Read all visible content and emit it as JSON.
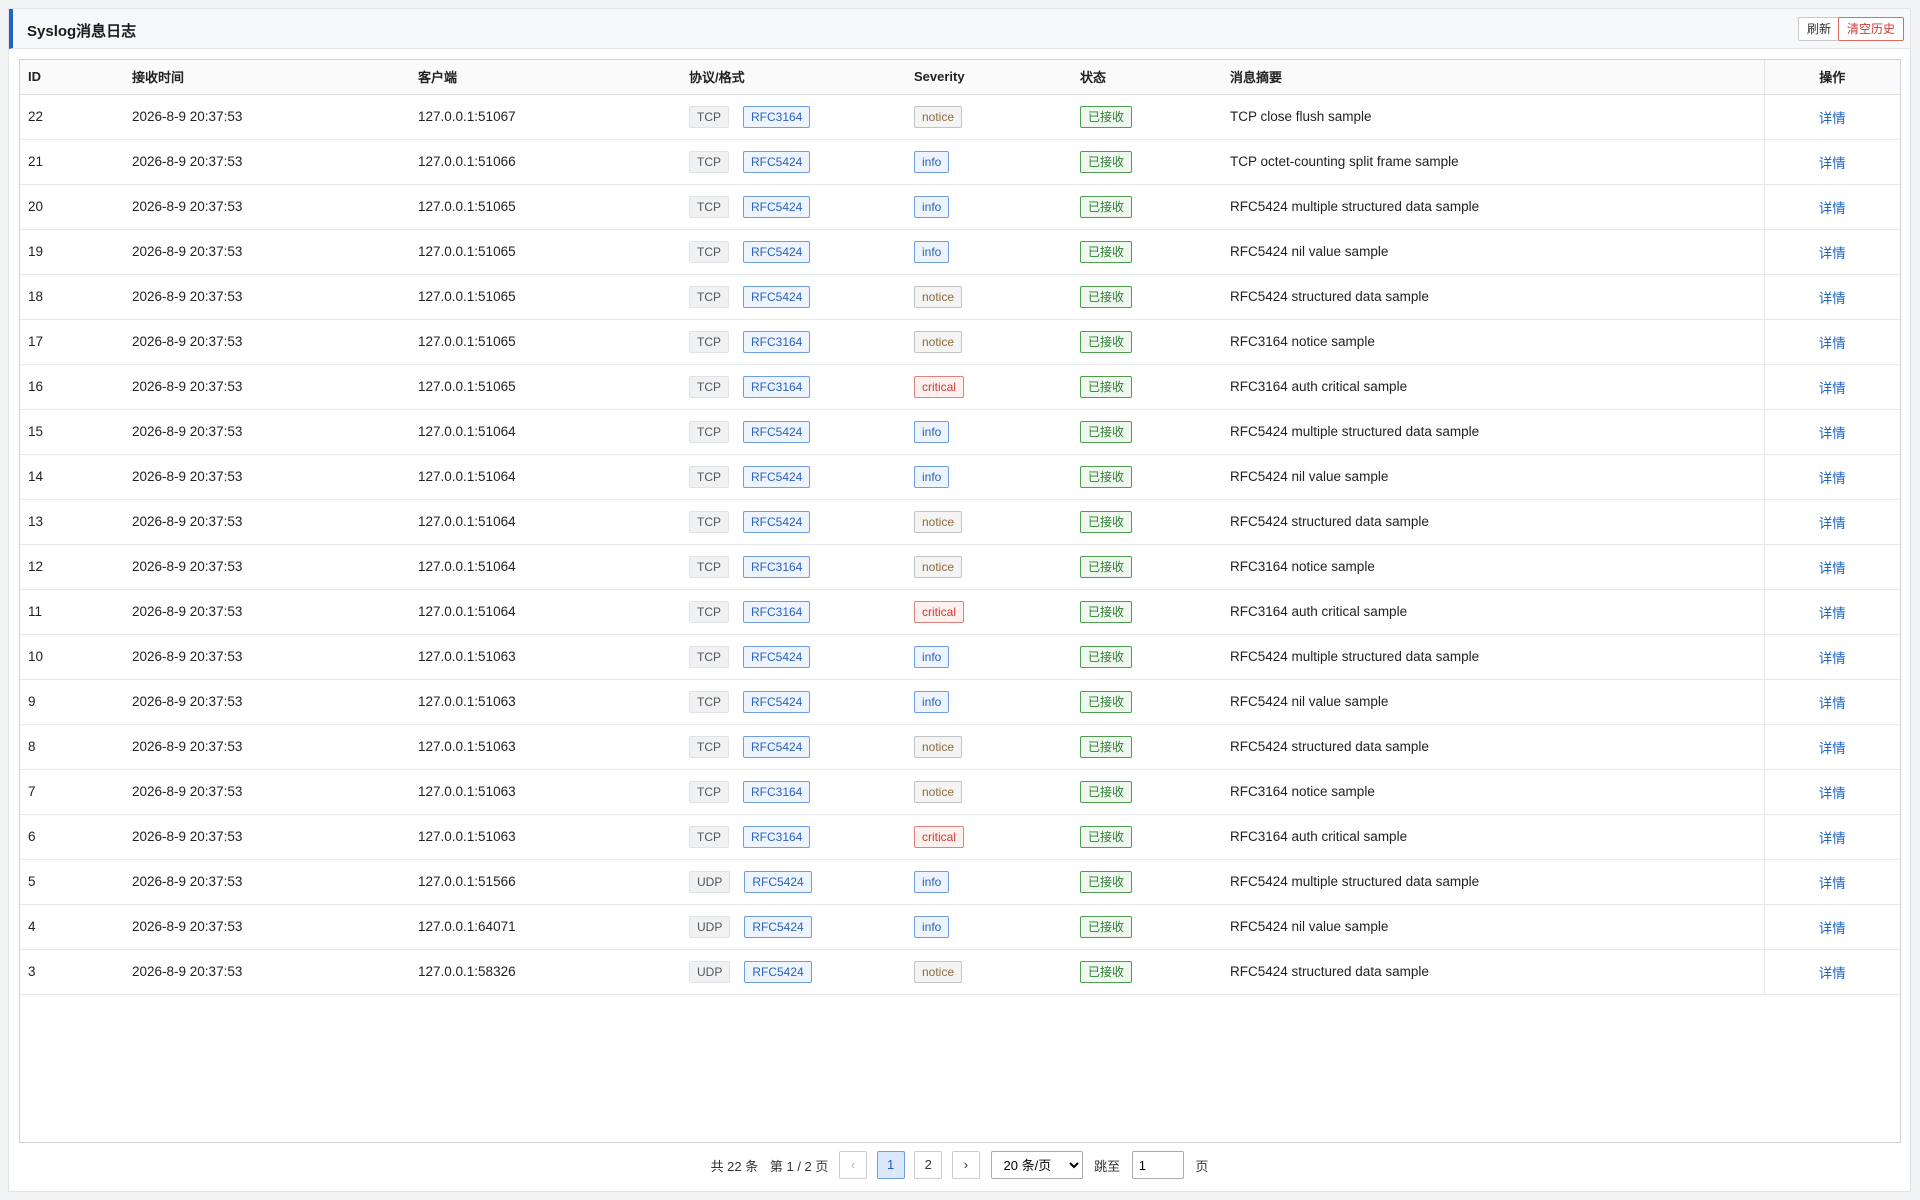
{
  "panel": {
    "title": "Syslog消息日志",
    "refresh_label": "刷新",
    "clear_label": "清空历史"
  },
  "table": {
    "headers": [
      "ID",
      "接收时间",
      "客户端",
      "协议/格式",
      "Severity",
      "状态",
      "消息摘要",
      "操作"
    ],
    "rows": [
      {
        "id": "22",
        "time": "2026-8-9 20:37:53",
        "client": "127.0.0.1:51067",
        "proto": "TCP",
        "fmt": "RFC3164",
        "severity": "notice",
        "status": "已接收",
        "summary": "TCP close flush sample",
        "action": "详情"
      },
      {
        "id": "21",
        "time": "2026-8-9 20:37:53",
        "client": "127.0.0.1:51066",
        "proto": "TCP",
        "fmt": "RFC5424",
        "severity": "info",
        "status": "已接收",
        "summary": "TCP octet-counting split frame sample",
        "action": "详情"
      },
      {
        "id": "20",
        "time": "2026-8-9 20:37:53",
        "client": "127.0.0.1:51065",
        "proto": "TCP",
        "fmt": "RFC5424",
        "severity": "info",
        "status": "已接收",
        "summary": "RFC5424 multiple structured data sample",
        "action": "详情"
      },
      {
        "id": "19",
        "time": "2026-8-9 20:37:53",
        "client": "127.0.0.1:51065",
        "proto": "TCP",
        "fmt": "RFC5424",
        "severity": "info",
        "status": "已接收",
        "summary": "RFC5424 nil value sample",
        "action": "详情"
      },
      {
        "id": "18",
        "time": "2026-8-9 20:37:53",
        "client": "127.0.0.1:51065",
        "proto": "TCP",
        "fmt": "RFC5424",
        "severity": "notice",
        "status": "已接收",
        "summary": "RFC5424 structured data sample",
        "action": "详情"
      },
      {
        "id": "17",
        "time": "2026-8-9 20:37:53",
        "client": "127.0.0.1:51065",
        "proto": "TCP",
        "fmt": "RFC3164",
        "severity": "notice",
        "status": "已接收",
        "summary": "RFC3164 notice sample",
        "action": "详情"
      },
      {
        "id": "16",
        "time": "2026-8-9 20:37:53",
        "client": "127.0.0.1:51065",
        "proto": "TCP",
        "fmt": "RFC3164",
        "severity": "critical",
        "status": "已接收",
        "summary": "RFC3164 auth critical sample",
        "action": "详情"
      },
      {
        "id": "15",
        "time": "2026-8-9 20:37:53",
        "client": "127.0.0.1:51064",
        "proto": "TCP",
        "fmt": "RFC5424",
        "severity": "info",
        "status": "已接收",
        "summary": "RFC5424 multiple structured data sample",
        "action": "详情"
      },
      {
        "id": "14",
        "time": "2026-8-9 20:37:53",
        "client": "127.0.0.1:51064",
        "proto": "TCP",
        "fmt": "RFC5424",
        "severity": "info",
        "status": "已接收",
        "summary": "RFC5424 nil value sample",
        "action": "详情"
      },
      {
        "id": "13",
        "time": "2026-8-9 20:37:53",
        "client": "127.0.0.1:51064",
        "proto": "TCP",
        "fmt": "RFC5424",
        "severity": "notice",
        "status": "已接收",
        "summary": "RFC5424 structured data sample",
        "action": "详情"
      },
      {
        "id": "12",
        "time": "2026-8-9 20:37:53",
        "client": "127.0.0.1:51064",
        "proto": "TCP",
        "fmt": "RFC3164",
        "severity": "notice",
        "status": "已接收",
        "summary": "RFC3164 notice sample",
        "action": "详情"
      },
      {
        "id": "11",
        "time": "2026-8-9 20:37:53",
        "client": "127.0.0.1:51064",
        "proto": "TCP",
        "fmt": "RFC3164",
        "severity": "critical",
        "status": "已接收",
        "summary": "RFC3164 auth critical sample",
        "action": "详情"
      },
      {
        "id": "10",
        "time": "2026-8-9 20:37:53",
        "client": "127.0.0.1:51063",
        "proto": "TCP",
        "fmt": "RFC5424",
        "severity": "info",
        "status": "已接收",
        "summary": "RFC5424 multiple structured data sample",
        "action": "详情"
      },
      {
        "id": "9",
        "time": "2026-8-9 20:37:53",
        "client": "127.0.0.1:51063",
        "proto": "TCP",
        "fmt": "RFC5424",
        "severity": "info",
        "status": "已接收",
        "summary": "RFC5424 nil value sample",
        "action": "详情"
      },
      {
        "id": "8",
        "time": "2026-8-9 20:37:53",
        "client": "127.0.0.1:51063",
        "proto": "TCP",
        "fmt": "RFC5424",
        "severity": "notice",
        "status": "已接收",
        "summary": "RFC5424 structured data sample",
        "action": "详情"
      },
      {
        "id": "7",
        "time": "2026-8-9 20:37:53",
        "client": "127.0.0.1:51063",
        "proto": "TCP",
        "fmt": "RFC3164",
        "severity": "notice",
        "status": "已接收",
        "summary": "RFC3164 notice sample",
        "action": "详情"
      },
      {
        "id": "6",
        "time": "2026-8-9 20:37:53",
        "client": "127.0.0.1:51063",
        "proto": "TCP",
        "fmt": "RFC3164",
        "severity": "critical",
        "status": "已接收",
        "summary": "RFC3164 auth critical sample",
        "action": "详情"
      },
      {
        "id": "5",
        "time": "2026-8-9 20:37:53",
        "client": "127.0.0.1:51566",
        "proto": "UDP",
        "fmt": "RFC5424",
        "severity": "info",
        "status": "已接收",
        "summary": "RFC5424 multiple structured data sample",
        "action": "详情"
      },
      {
        "id": "4",
        "time": "2026-8-9 20:37:53",
        "client": "127.0.0.1:64071",
        "proto": "UDP",
        "fmt": "RFC5424",
        "severity": "info",
        "status": "已接收",
        "summary": "RFC5424 nil value sample",
        "action": "详情"
      },
      {
        "id": "3",
        "time": "2026-8-9 20:37:53",
        "client": "127.0.0.1:58326",
        "proto": "UDP",
        "fmt": "RFC5424",
        "severity": "notice",
        "status": "已接收",
        "summary": "RFC5424 structured data sample",
        "action": "详情"
      }
    ]
  },
  "pagination": {
    "total_text": "共 22 条",
    "page_text": "第 1 / 2 页",
    "prev_label": "‹",
    "pages": [
      "1",
      "2"
    ],
    "next_label": "›",
    "page_size_selected": "20 条/页",
    "jump_label": "跳至",
    "jump_value": "1",
    "page_suffix": "页"
  }
}
